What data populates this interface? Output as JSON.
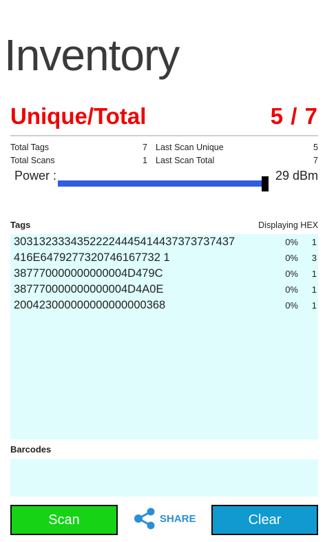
{
  "header": {
    "title": "Inventory"
  },
  "summary": {
    "label": "Unique/Total",
    "value": "5 / 7"
  },
  "stats": {
    "total_tags_label": "Total Tags",
    "total_tags": "7",
    "last_scan_unique_label": "Last Scan Unique",
    "last_scan_unique": "5",
    "total_scans_label": "Total Scans",
    "total_scans": "1",
    "last_scan_total_label": "Last Scan Total",
    "last_scan_total": "7"
  },
  "power": {
    "label": "Power :",
    "value": "29 dBm",
    "level_fraction": 0.99
  },
  "tags": {
    "title": "Tags",
    "display_mode": "Displaying HEX",
    "rows": [
      {
        "epc": "30313233343522224445414437373737437",
        "pct": "0%",
        "count": "1"
      },
      {
        "epc": "416E6479277320746167732 1",
        "pct": "0%",
        "count": "3"
      },
      {
        "epc": "387770000000000004D479C",
        "pct": "0%",
        "count": "1"
      },
      {
        "epc": "387770000000000004D4A0E",
        "pct": "0%",
        "count": "1"
      },
      {
        "epc": "200423000000000000000368",
        "pct": "0%",
        "count": "1"
      }
    ]
  },
  "barcodes": {
    "title": "Barcodes"
  },
  "buttons": {
    "scan_label": "Scan",
    "share_label": "SHARE",
    "clear_label": "Clear"
  },
  "colors": {
    "accent_red": "#f00000",
    "list_bg": "#dffdfd",
    "power_bar": "#2f5fde",
    "scan_green": "#16d316",
    "clear_blue": "#109acf",
    "share_blue": "#2a8fd8"
  }
}
